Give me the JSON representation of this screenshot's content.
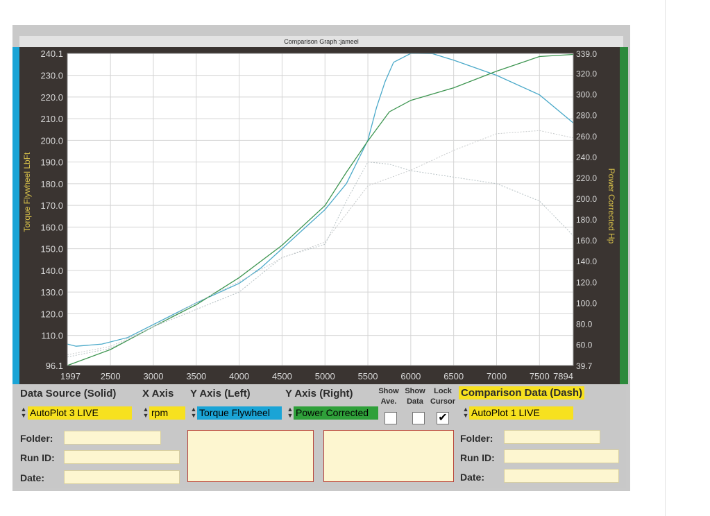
{
  "window": {
    "title": "Comparison Graph :jameel"
  },
  "colors": {
    "torque": "#4aa9c9",
    "power": "#3d9550",
    "left_strip": "#1aa4d6",
    "right_strip": "#2d8a3c",
    "field_yellow": "#f7e11f",
    "field_cream": "#fdf6d0"
  },
  "chart_data": {
    "type": "line",
    "title": "Comparison Graph :jameel",
    "xlabel": "",
    "ylabel": "Torque Flywheel LbFt",
    "y2label": "Power Corrected Hp",
    "xlim": [
      1997,
      7894
    ],
    "ylim": [
      96.1,
      240.1
    ],
    "y2lim": [
      39.7,
      339.0
    ],
    "x_ticks": [
      "1997",
      "2500",
      "3000",
      "3500",
      "4000",
      "4500",
      "5000",
      "5500",
      "6000",
      "6500",
      "7000",
      "7500",
      "7894"
    ],
    "y_ticks": [
      "96.1",
      "110.0",
      "120.0",
      "130.0",
      "140.0",
      "150.0",
      "160.0",
      "170.0",
      "180.0",
      "190.0",
      "200.0",
      "210.0",
      "220.0",
      "230.0",
      "240.1"
    ],
    "y2_ticks": [
      "39.7",
      "60.0",
      "80.0",
      "100.0",
      "120.0",
      "140.0",
      "160.0",
      "180.0",
      "200.0",
      "220.0",
      "240.0",
      "260.0",
      "280.0",
      "300.0",
      "320.0",
      "339.0"
    ],
    "grid": true,
    "series": [
      {
        "label": "Torque (solid)",
        "axis": "left",
        "style": "solid",
        "color": "#4aa9c9",
        "x": [
          1997,
          2100,
          2400,
          2700,
          3000,
          3500,
          4000,
          4250,
          4500,
          4750,
          5000,
          5250,
          5500,
          5600,
          5700,
          5800,
          6000,
          6250,
          6500,
          7000,
          7500,
          7894
        ],
        "y": [
          106,
          105,
          106,
          109,
          115,
          125,
          134,
          141,
          150,
          159,
          168,
          180,
          200,
          215,
          227,
          236,
          240.1,
          240,
          237,
          230,
          221,
          208
        ]
      },
      {
        "label": "Power (solid)",
        "axis": "right",
        "style": "solid",
        "color": "#3d9550",
        "x": [
          1997,
          2500,
          3000,
          3500,
          4000,
          4500,
          5000,
          5250,
          5500,
          5750,
          6000,
          6500,
          7000,
          7500,
          7894
        ],
        "y": [
          39.7,
          55,
          77,
          98,
          124,
          155,
          193,
          225,
          255,
          283,
          294,
          306,
          322,
          336,
          338
        ]
      },
      {
        "label": "Torque (dash)",
        "axis": "left",
        "style": "dash",
        "color": "#b8c2c5",
        "x": [
          1997,
          2500,
          3000,
          3500,
          4000,
          4500,
          5000,
          5250,
          5500,
          5750,
          6000,
          6500,
          7000,
          7500,
          7894
        ],
        "y": [
          100,
          104,
          114,
          122,
          130,
          146,
          152,
          172,
          190,
          189,
          186,
          183,
          180,
          172,
          156
        ]
      },
      {
        "label": "Power (dash)",
        "axis": "right",
        "style": "dash",
        "color": "#c8cbcc",
        "x": [
          1997,
          2500,
          3000,
          3500,
          4000,
          4500,
          5000,
          5500,
          6000,
          6500,
          7000,
          7500,
          7894
        ],
        "y": [
          50,
          58,
          77,
          100,
          120,
          143,
          158,
          212,
          227,
          246,
          262,
          265,
          258
        ]
      }
    ]
  },
  "panel": {
    "data_source_label": "Data Source (Solid)",
    "x_axis_label": "X Axis",
    "y_left_label": "Y Axis (Left)",
    "y_right_label": "Y Axis (Right)",
    "show_ave_label": "Show\nAve.",
    "show_data_label": "Show\nData",
    "lock_cursor_label": "Lock\nCursor",
    "comparison_label": "Comparison Data (Dash)",
    "data_source_value": "AutoPlot 3 LIVE",
    "x_axis_value": "rpm",
    "y_left_value": "Torque Flywheel",
    "y_right_value": "Power Corrected",
    "comparison_value": "AutoPlot 1 LIVE",
    "lock_cursor_checked": true,
    "folder_label": "Folder:",
    "run_id_label": "Run ID:",
    "date_label": "Date:",
    "folder2_label": "Folder:",
    "run_id2_label": "Run ID:",
    "date2_label": "Date:"
  }
}
